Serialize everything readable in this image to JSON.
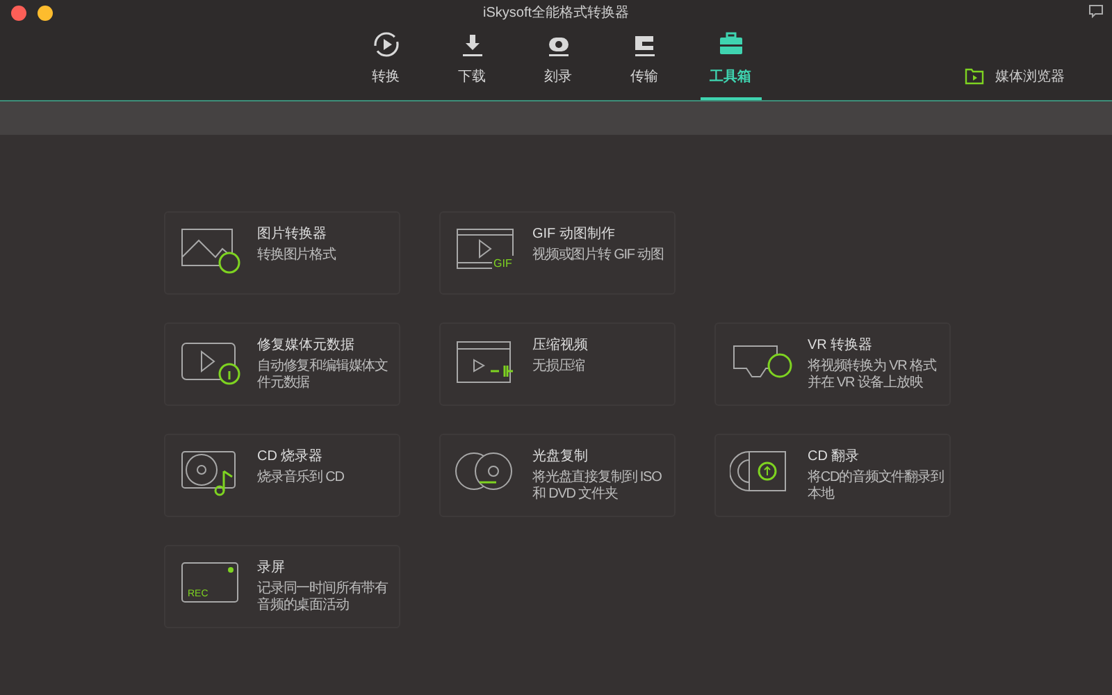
{
  "window": {
    "title": "iSkysoft全能格式转换器"
  },
  "tabs": [
    {
      "label": "转换",
      "selected": false
    },
    {
      "label": "下载",
      "selected": false
    },
    {
      "label": "刻录",
      "selected": false
    },
    {
      "label": "传输",
      "selected": false
    },
    {
      "label": "工具箱",
      "selected": true
    }
  ],
  "media_browser": {
    "label": "媒体浏览器"
  },
  "tool_rows": [
    [
      {
        "kind": "image",
        "title": "图片转换器",
        "description": "转换图片格式"
      },
      {
        "kind": "gif",
        "badge": "GIF",
        "title": "GIF 动图制作",
        "description": "视频或图片转 GIF 动图"
      }
    ],
    [
      {
        "kind": "metadata",
        "title": "修复媒体元数据",
        "description": "自动修复和编辑媒体文件元数据"
      },
      {
        "kind": "compress",
        "title": "压缩视频",
        "description": "无损压缩"
      },
      {
        "kind": "vr",
        "title": "VR 转换器",
        "description": "将视频转换为 VR 格式并在 VR 设备上放映"
      }
    ],
    [
      {
        "kind": "cdburn",
        "title": "CD 烧录器",
        "description": "烧录音乐到 CD"
      },
      {
        "kind": "dvdcopy",
        "title": "光盘复制",
        "description": "将光盘直接复制到 ISO 和 DVD 文件夹"
      },
      {
        "kind": "cdrip",
        "title": "CD 翻录",
        "description": "将CD的音频文件翻录到本地"
      }
    ],
    [
      {
        "kind": "record",
        "badge": "REC",
        "title": "录屏",
        "description": "记录同一时间所有带有音频的桌面活动"
      }
    ]
  ]
}
